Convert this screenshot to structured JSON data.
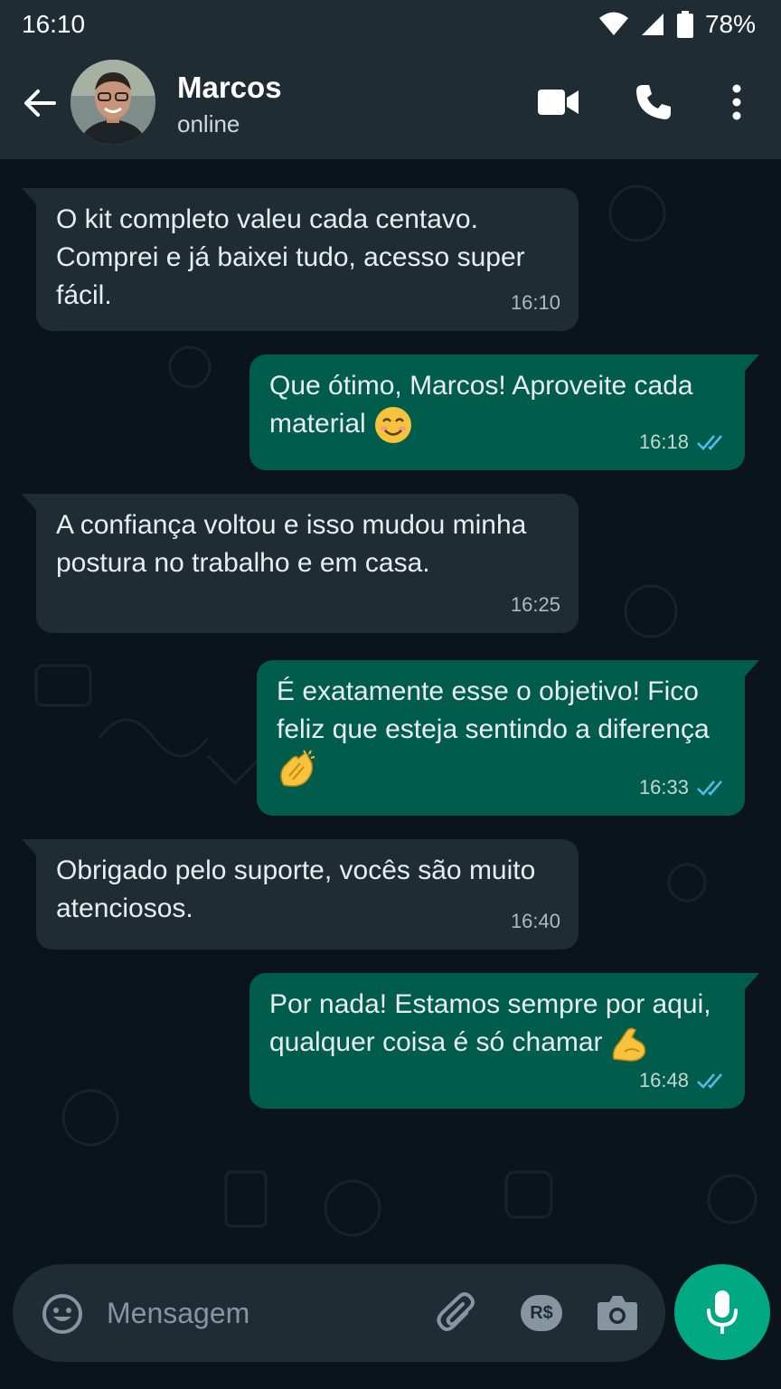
{
  "status_bar": {
    "time": "16:10",
    "battery": "78%"
  },
  "header": {
    "name": "Marcos",
    "status": "online"
  },
  "messages": [
    {
      "direction": "in",
      "text": "O kit completo valeu cada centavo. Comprei e já baixei tudo, acesso super fácil.",
      "time": "16:10"
    },
    {
      "direction": "out",
      "text": "Que ótimo, Marcos! Aproveite cada material",
      "emoji": "smiling-face",
      "time": "16:18",
      "read": true
    },
    {
      "direction": "in",
      "text": "A confiança voltou e isso mudou minha postura no trabalho e em casa.",
      "time": "16:25"
    },
    {
      "direction": "out",
      "text": "É exatamente esse o objetivo! Fico feliz que esteja sentindo a diferença",
      "emoji": "clapping-hands",
      "time": "16:33",
      "read": true
    },
    {
      "direction": "in",
      "text": "Obrigado pelo suporte, vocês são muito atenciosos.",
      "time": "16:40"
    },
    {
      "direction": "out",
      "text": "Por nada! Estamos sempre por aqui, qualquer coisa é só chamar",
      "emoji": "flexed-biceps",
      "time": "16:48",
      "read": true
    }
  ],
  "composer": {
    "placeholder": "Mensagem",
    "payment_label": "R$"
  },
  "colors": {
    "header": "#1f2c34",
    "incoming": "#1f2c34",
    "outgoing": "#005c4b",
    "accent": "#00a884",
    "read_tick": "#53bdeb"
  }
}
